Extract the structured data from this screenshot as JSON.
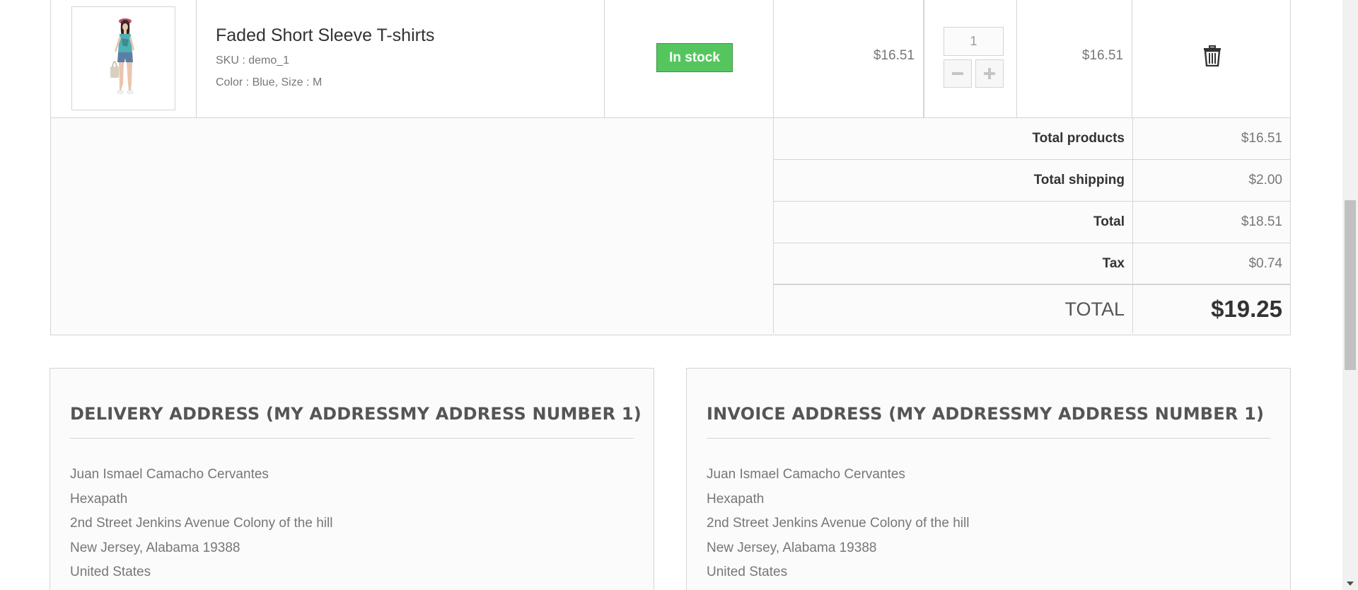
{
  "cart": {
    "product": {
      "name": "Faded Short Sleeve T-shirts",
      "sku": "SKU : demo_1",
      "attributes": "Color : Blue, Size : M",
      "availability": "In stock",
      "unit_price": "$16.51",
      "quantity": "1",
      "total": "$16.51",
      "stock_color": "#55c65e"
    },
    "totals": [
      {
        "label": "Total products",
        "value": "$16.51"
      },
      {
        "label": "Total shipping",
        "value": "$2.00"
      },
      {
        "label": "Total",
        "value": "$18.51"
      },
      {
        "label": "Tax",
        "value": "$0.74"
      }
    ],
    "grand_total": {
      "label": "TOTAL",
      "value": "$19.25"
    }
  },
  "delivery_address": {
    "title": "DELIVERY ADDRESS (MY ADDRESSMY ADDRESS NUMBER 1)",
    "lines": [
      "Juan Ismael Camacho Cervantes",
      "Hexapath",
      "2nd Street Jenkins Avenue Colony of the hill",
      "New Jersey, Alabama 19388",
      "United States"
    ]
  },
  "invoice_address": {
    "title": "INVOICE ADDRESS (MY ADDRESSMY ADDRESS NUMBER 1)",
    "lines": [
      "Juan Ismael Camacho Cervantes",
      "Hexapath",
      "2nd Street Jenkins Avenue Colony of the hill",
      "New Jersey, Alabama 19388",
      "United States"
    ]
  },
  "icons": {
    "delete": "trash-icon",
    "decrease": "minus-icon",
    "increase": "plus-icon"
  }
}
